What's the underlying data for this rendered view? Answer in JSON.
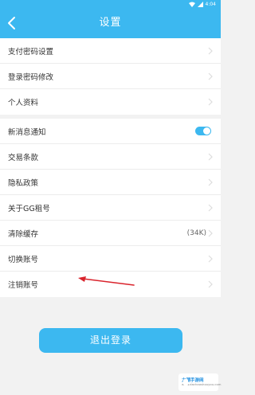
{
  "status_bar": {
    "time": "4:04"
  },
  "header": {
    "title": "设置"
  },
  "group1": [
    {
      "label": "支付密码设置"
    },
    {
      "label": "登录密码修改"
    },
    {
      "label": "个人资料"
    }
  ],
  "group2": [
    {
      "label": "新消息通知",
      "toggle": true
    },
    {
      "label": "交易条款"
    },
    {
      "label": "隐私政策"
    },
    {
      "label": "关于GG租号"
    },
    {
      "label": "清除缓存",
      "value": "(34K)"
    },
    {
      "label": "切换账号"
    },
    {
      "label": "注销账号"
    }
  ],
  "logout_label": "退出登录",
  "watermark": {
    "line1": "大潮手游网",
    "line2": "www.dachaoshouyou.com"
  },
  "colors": {
    "accent": "#3cb8f0",
    "background": "#f2f2f2",
    "arrow": "#d9232c"
  }
}
